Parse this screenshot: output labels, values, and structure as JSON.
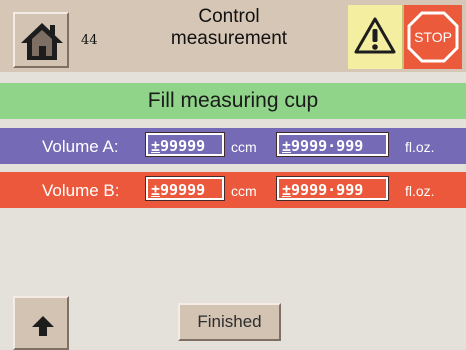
{
  "header": {
    "screen_number": "44",
    "title_line1": "Control",
    "title_line2": "measurement",
    "icons": {
      "home": "home-icon",
      "warning": "warning-icon",
      "stop": "stop-icon"
    },
    "stop_label": "STOP"
  },
  "banner": {
    "label": "Fill measuring cup"
  },
  "rows": {
    "volume_a": {
      "label": "Volume A:",
      "ccm_sign": "±",
      "ccm_value": "99999",
      "ccm_unit": "ccm",
      "floz_sign": "±",
      "floz_value": "9999·999",
      "floz_unit": "fl.oz."
    },
    "volume_b": {
      "label": "Volume B:",
      "ccm_sign": "±",
      "ccm_value": "99999",
      "ccm_unit": "ccm",
      "floz_sign": "±",
      "floz_value": "9999·999",
      "floz_unit": "fl.oz."
    }
  },
  "footer": {
    "up_icon": "arrow-up-icon",
    "finished_label": "Finished"
  },
  "colors": {
    "header_bg": "#d6c6b5",
    "banner": "#90d48a",
    "volume_a": "#756ab6",
    "volume_b": "#ec583b",
    "warning_bg": "#f4eea1",
    "stop_bg": "#eb5a3b"
  }
}
